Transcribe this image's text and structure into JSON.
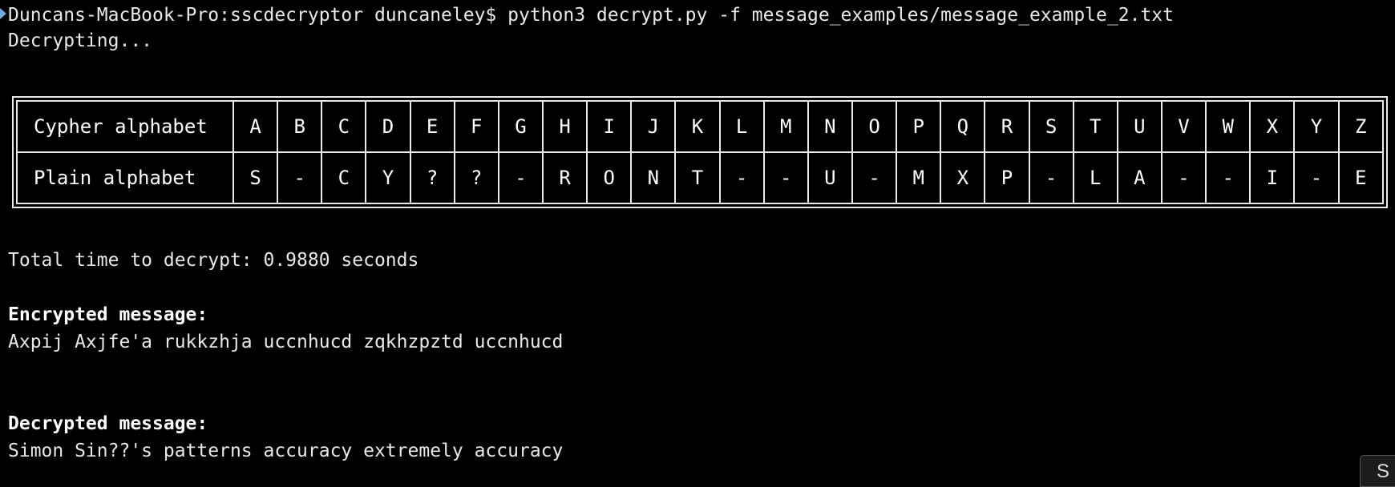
{
  "prompt": "Duncans-MacBook-Pro:sscdecryptor duncaneley$ python3 decrypt.py -f message_examples/message_example_2.txt",
  "status": "Decrypting...",
  "table": {
    "row1_label": "Cypher alphabet",
    "row2_label": "Plain alphabet",
    "cypher": [
      "A",
      "B",
      "C",
      "D",
      "E",
      "F",
      "G",
      "H",
      "I",
      "J",
      "K",
      "L",
      "M",
      "N",
      "O",
      "P",
      "Q",
      "R",
      "S",
      "T",
      "U",
      "V",
      "W",
      "X",
      "Y",
      "Z"
    ],
    "plain": [
      "S",
      "-",
      "C",
      "Y",
      "?",
      "?",
      "-",
      "R",
      "O",
      "N",
      "T",
      "-",
      "-",
      "U",
      "-",
      "M",
      "X",
      "P",
      "-",
      "L",
      "A",
      "-",
      "-",
      "I",
      "-",
      "E"
    ]
  },
  "time_line": "Total time to decrypt: 0.9880 seconds",
  "encrypted_heading": "Encrypted message:",
  "encrypted_text": "Axpij Axjfe'a rukkzhja uccnhucd zqkhzpztd uccnhucd",
  "decrypted_heading": "Decrypted message:",
  "decrypted_text": "Simon Sin??'s patterns accuracy extremely accuracy",
  "corner_button_label": "S",
  "colors": {
    "background": "#000000",
    "text": "#e8e8e8",
    "marker": "#6fa8dc"
  }
}
